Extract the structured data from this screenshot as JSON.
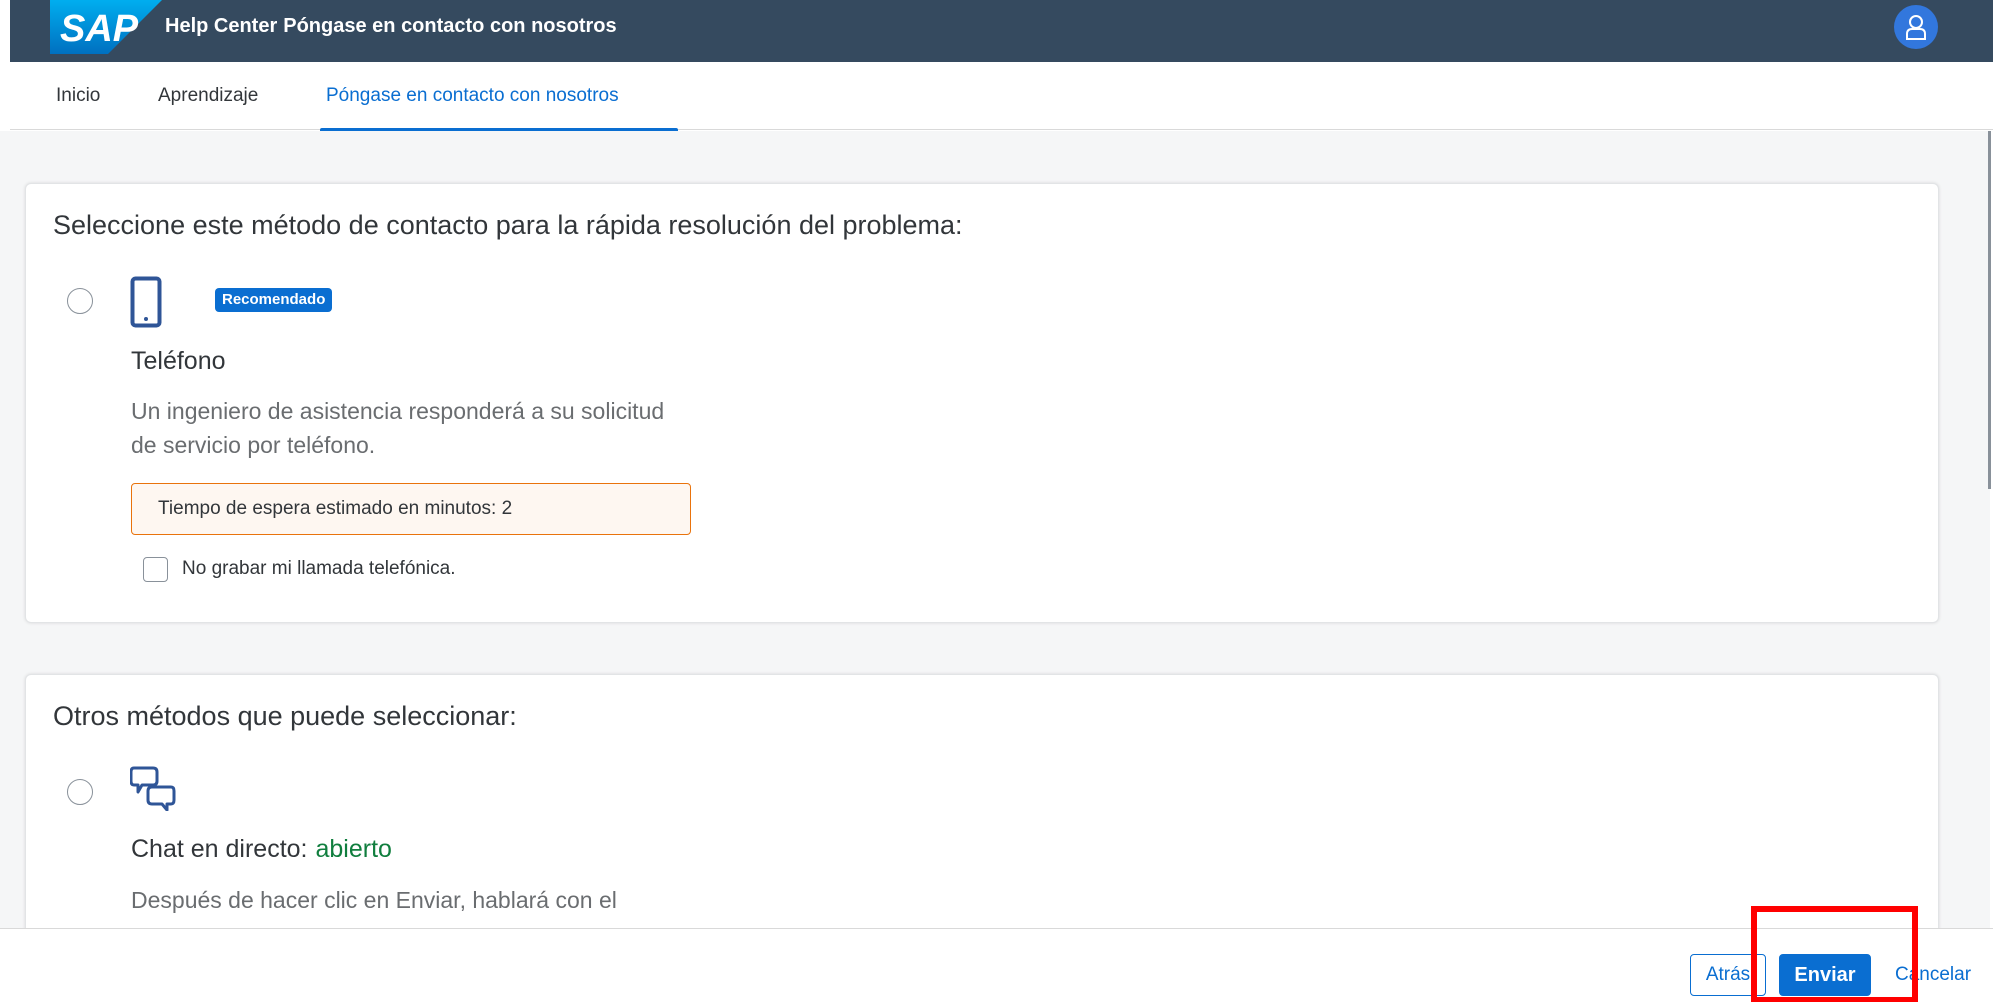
{
  "shellbar": {
    "logo_text": "SAP",
    "app_title": "Help Center",
    "page_title": "Póngase en contacto con nosotros",
    "avatar_icon": "user-icon",
    "background_color": "#354a5f"
  },
  "tabs": [
    {
      "label": "Inicio",
      "active": false
    },
    {
      "label": "Aprendizaje",
      "active": false
    },
    {
      "label": "Póngase en contacto con nosotros",
      "active": true
    }
  ],
  "recommended_section": {
    "heading": "Seleccione este método de contacto para la rápida resolución del problema:",
    "method": {
      "icon": "phone-icon",
      "badge": "Recomendado",
      "title": "Teléfono",
      "description": "Un ingeniero de asistencia responderá a su solicitud de servicio por teléfono.",
      "wait_time_text": "Tiempo de espera estimado en minutos: 2",
      "checkbox_label": "No grabar mi llamada telefónica.",
      "selected": false,
      "checkbox_checked": false
    }
  },
  "other_section": {
    "heading": "Otros métodos que puede seleccionar:",
    "method": {
      "icon": "chat-bubbles-icon",
      "title": "Chat en directo:",
      "status": "abierto",
      "description": "Después de hacer clic en Enviar, hablará con el",
      "selected": false
    }
  },
  "footer": {
    "back_label": "Atrás",
    "submit_label": "Enviar",
    "cancel_label": "Cancelar"
  },
  "colors": {
    "accent": "#0a6ed1",
    "status_open": "#107e3e",
    "warning_border": "#e9730c",
    "highlight": "#ff0000"
  }
}
